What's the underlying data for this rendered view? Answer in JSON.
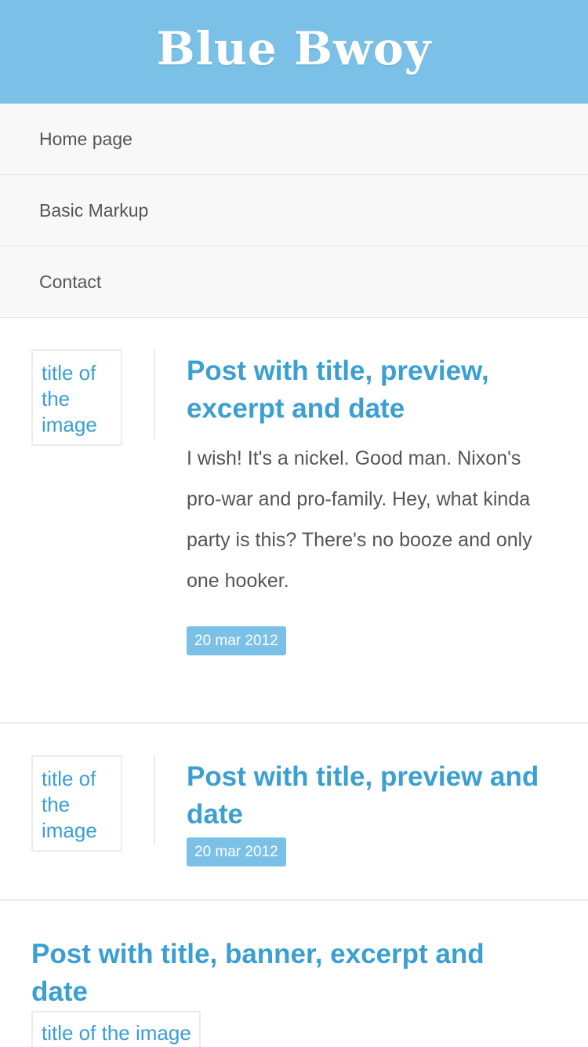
{
  "site": {
    "title": "Blue Bwoy",
    "header_color": "#7bc0e7",
    "accent_color": "#3a9fd1"
  },
  "nav": {
    "items": [
      {
        "label": "Home page"
      },
      {
        "label": "Basic Markup"
      },
      {
        "label": "Contact"
      }
    ]
  },
  "posts": [
    {
      "image_alt": "title of the image",
      "title": "Post with title, preview, excerpt and date",
      "excerpt": "I wish! It's a nickel. Good man. Nixon's pro-war and pro-family. Hey, what kinda party is this? There's no booze and only one hooker.",
      "date": "20 mar 2012"
    },
    {
      "image_alt": "title of the image",
      "title": "Post with title, preview and date",
      "date": "20 mar 2012"
    },
    {
      "title": "Post with title, banner, excerpt and date",
      "banner_alt": "title of the image"
    }
  ]
}
